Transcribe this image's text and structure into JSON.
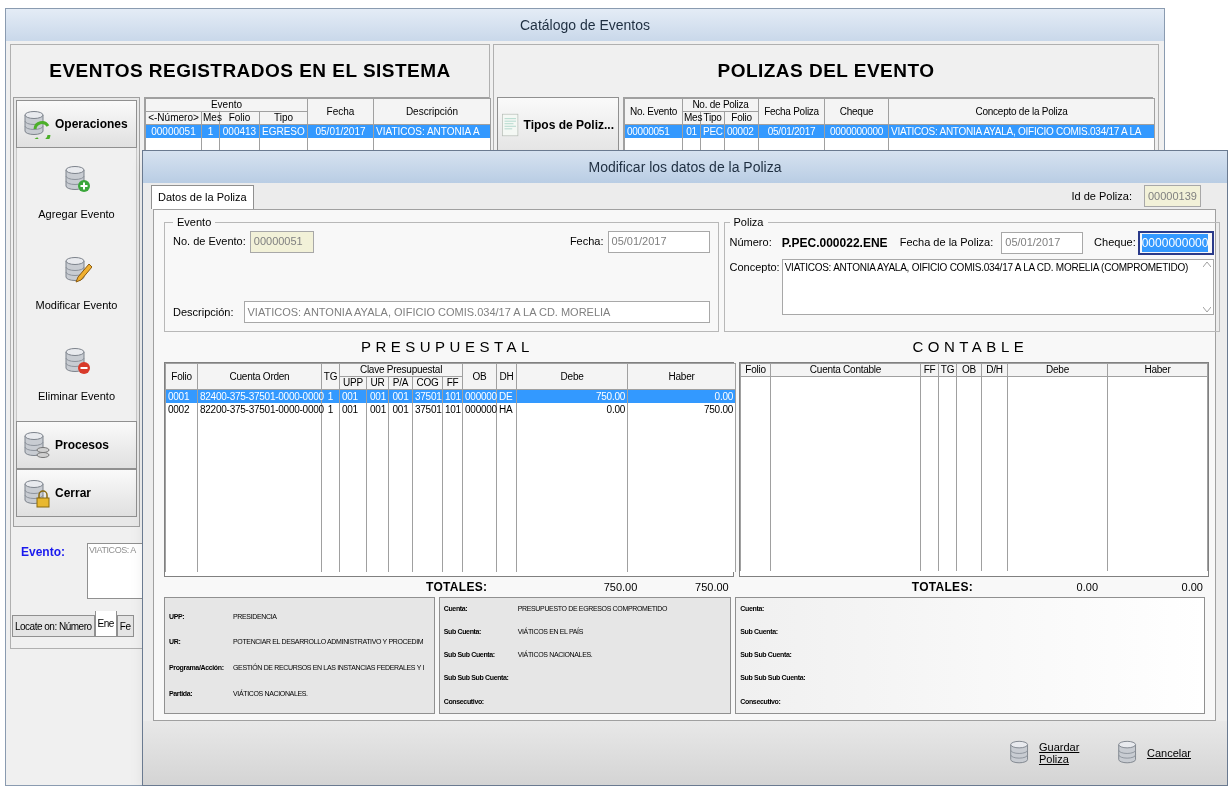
{
  "window": {
    "title": "Catálogo de Eventos"
  },
  "eventos": {
    "title": "EVENTOS REGISTRADOS EN EL SISTEMA",
    "sidebar": [
      {
        "kind": "group",
        "label": "Operaciones"
      },
      {
        "kind": "action",
        "label": "Agregar Evento"
      },
      {
        "kind": "action",
        "label": "Modificar Evento"
      },
      {
        "kind": "action",
        "label": "Eliminar Evento"
      },
      {
        "kind": "group",
        "label": "Procesos"
      },
      {
        "kind": "group",
        "label": "Cerrar"
      }
    ],
    "table": {
      "column_groups": [
        {
          "label": "Evento",
          "columns": [
            "<-Número>",
            "Mes",
            "Folio",
            "Tipo"
          ]
        },
        {
          "columns": [
            "Fecha"
          ]
        },
        {
          "columns": [
            "Descripción"
          ]
        }
      ],
      "rows": [
        {
          "cells": [
            "00000051",
            "1",
            "000413",
            "EGRESO",
            "05/01/2017",
            "VIATICOS: ANTONIA A"
          ],
          "selected": true
        }
      ]
    },
    "evento_label": "Evento:",
    "evento_text": "VIATICOS: A",
    "tabs": [
      {
        "label": "Locate on: Número",
        "selected": false
      },
      {
        "label": "Ene",
        "selected": true
      },
      {
        "label": "Fe",
        "selected": false
      }
    ]
  },
  "polizas": {
    "title": "POLIZAS DEL EVENTO",
    "tipos_button": "Tipos de Poliz...",
    "table": {
      "column_groups": [
        {
          "columns": [
            "No. Evento"
          ]
        },
        {
          "label": "No. de Poliza",
          "columns": [
            "Mes",
            "Tipo",
            "Folio"
          ]
        },
        {
          "columns": [
            "Fecha Poliza"
          ]
        },
        {
          "columns": [
            "Cheque"
          ]
        },
        {
          "columns": [
            "Concepto de la Poliza"
          ]
        }
      ],
      "rows": [
        {
          "cells": [
            "00000051",
            "01",
            "PEC",
            "00002",
            "05/01/2017",
            "0000000000",
            "VIATICOS: ANTONIA AYALA, OIFICIO COMIS.034/17 A LA"
          ],
          "selected": true
        }
      ]
    }
  },
  "dialog": {
    "title": "Modificar los datos de la Poliza",
    "tabs": [
      {
        "label": "Datos de la Poliza",
        "selected": true
      }
    ],
    "id_label": "Id de Poliza:",
    "id_value": "00000139",
    "evento": {
      "legend": "Evento",
      "numero_label": "No. de Evento:",
      "numero": "00000051",
      "fecha_label": "Fecha:",
      "fecha": "05/01/2017",
      "descripcion_label": "Descripción:",
      "descripcion": "VIATICOS: ANTONIA AYALA, OIFICIO COMIS.034/17 A LA CD. MORELIA"
    },
    "poliza": {
      "legend": "Poliza",
      "numero_label": "Número:",
      "numero": "P.PEC.000022.ENE",
      "fecha_label": "Fecha de la Poliza:",
      "fecha": "05/01/2017",
      "cheque_label": "Cheque:",
      "cheque": "0000000000",
      "cheque_focused": true,
      "concepto_label": "Concepto:",
      "concepto": "VIATICOS: ANTONIA AYALA, OIFICIO COMIS.034/17 A LA CD. MORELIA (COMPROMETIDO)"
    },
    "presupuestal": {
      "title": "PRESUPUESTAL",
      "column_groups": [
        {
          "columns": [
            "Folio"
          ]
        },
        {
          "columns": [
            "Cuenta Orden"
          ]
        },
        {
          "columns": [
            "TG"
          ]
        },
        {
          "label": "Clave Presupuestal",
          "columns": [
            "UPP",
            "UR",
            "P/A",
            "COG",
            "FF"
          ]
        },
        {
          "columns": [
            "OB"
          ]
        },
        {
          "columns": [
            "DH"
          ]
        },
        {
          "columns": [
            "Debe"
          ]
        },
        {
          "columns": [
            "Haber"
          ]
        }
      ],
      "rows": [
        {
          "cells": [
            "0001",
            "82400-375-37501-0000-0000",
            "1",
            "001",
            "001",
            "001",
            "37501",
            "101",
            "000000",
            "DE",
            "750.00",
            "0.00"
          ],
          "selected": true
        },
        {
          "cells": [
            "0002",
            "82200-375-37501-0000-0000",
            "1",
            "001",
            "001",
            "001",
            "37501",
            "101",
            "000000",
            "HA",
            "0.00",
            "750.00"
          ],
          "selected": false
        }
      ],
      "totals_label": "TOTALES:",
      "totals": [
        "750.00",
        "750.00"
      ]
    },
    "contable": {
      "title": "CONTABLE",
      "column_groups": [
        {
          "columns": [
            "Folio"
          ]
        },
        {
          "columns": [
            "Cuenta Contable"
          ]
        },
        {
          "columns": [
            "FF"
          ]
        },
        {
          "columns": [
            "TG"
          ]
        },
        {
          "columns": [
            "OB"
          ]
        },
        {
          "columns": [
            "D/H"
          ]
        },
        {
          "columns": [
            "Debe"
          ]
        },
        {
          "columns": [
            "Haber"
          ]
        }
      ],
      "totals_label": "TOTALES:",
      "totals": [
        "0.00",
        "0.00"
      ]
    },
    "info_panels": [
      {
        "fields": [
          {
            "label": "UPP:",
            "value": "PRESIDENCIA"
          },
          {
            "label": "UR:",
            "value": "POTENCIAR EL DESARROLLO ADMINISTRATIVO Y PROCEDIM"
          },
          {
            "label": "Programa/Acción:",
            "value": "GESTIÓN DE RECURSOS EN LAS INSTANCIAS FEDERALES Y I"
          },
          {
            "label": "Partida:",
            "value": "VIÁTICOS NACIONALES."
          }
        ]
      },
      {
        "fields": [
          {
            "label": "Cuenta:",
            "value": "PRESUPUESTO DE EGRESOS COMPROMETIDO"
          },
          {
            "label": "Sub Cuenta:",
            "value": "VIÁTICOS EN EL PAÍS"
          },
          {
            "label": "Sub Sub Cuenta:",
            "value": "VIÁTICOS NACIONALES."
          },
          {
            "label": "Sub Sub Sub Cuenta:"
          },
          {
            "label": "Consecutivo:"
          }
        ]
      },
      {
        "fields": [
          {
            "label": "Cuenta:"
          },
          {
            "label": "Sub Cuenta:"
          },
          {
            "label": "Sub Sub Cuenta:"
          },
          {
            "label": "Sub Sub Sub Cuenta:"
          },
          {
            "label": "Consecutivo:"
          }
        ]
      }
    ],
    "buttons": [
      {
        "label": "Guardar Poliza"
      },
      {
        "label": "Cancelar"
      }
    ]
  }
}
